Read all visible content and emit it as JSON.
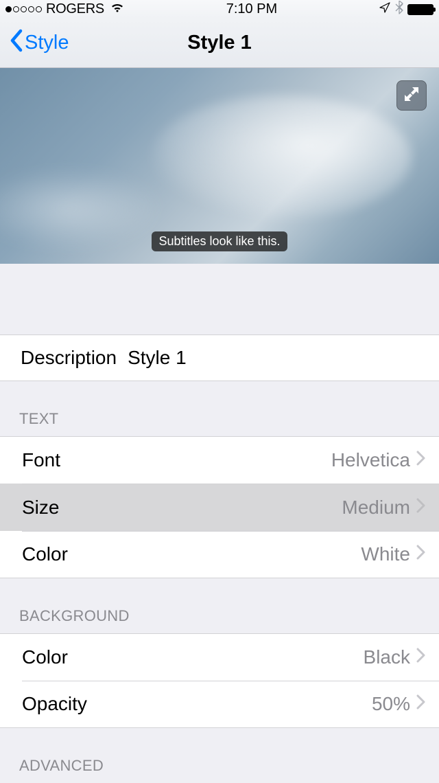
{
  "statusBar": {
    "carrier": "ROGERS",
    "time": "7:10 PM"
  },
  "nav": {
    "backLabel": "Style",
    "title": "Style 1"
  },
  "preview": {
    "subtitleSample": "Subtitles look like this."
  },
  "description": {
    "label": "Description",
    "value": "Style 1"
  },
  "sections": {
    "text": {
      "header": "TEXT",
      "font": {
        "label": "Font",
        "value": "Helvetica"
      },
      "size": {
        "label": "Size",
        "value": "Medium"
      },
      "color": {
        "label": "Color",
        "value": "White"
      }
    },
    "background": {
      "header": "BACKGROUND",
      "color": {
        "label": "Color",
        "value": "Black"
      },
      "opacity": {
        "label": "Opacity",
        "value": "50%"
      }
    },
    "advanced": {
      "header": "ADVANCED"
    }
  }
}
